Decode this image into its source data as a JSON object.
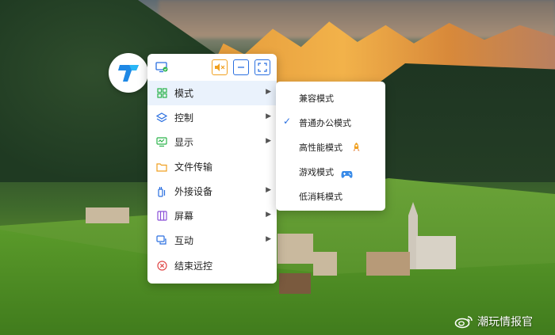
{
  "toolbar": {
    "screen_icon": "monitor-check-icon",
    "mute_icon": "speaker-mute-icon",
    "minimize_icon": "minimize-icon",
    "fullscreen_icon": "fullscreen-icon",
    "accent_color": "#f0a020"
  },
  "menu": {
    "items": [
      {
        "label": "模式",
        "icon": "grid-icon",
        "has_submenu": true,
        "active": true
      },
      {
        "label": "控制",
        "icon": "layers-icon",
        "has_submenu": true
      },
      {
        "label": "显示",
        "icon": "display-icon",
        "has_submenu": true
      },
      {
        "label": "文件传输",
        "icon": "folder-icon",
        "has_submenu": false
      },
      {
        "label": "外接设备",
        "icon": "plug-icon",
        "has_submenu": true
      },
      {
        "label": "屏幕",
        "icon": "screen-icon",
        "has_submenu": true
      },
      {
        "label": "互动",
        "icon": "chat-icon",
        "has_submenu": true
      },
      {
        "label": "结束远控",
        "icon": "close-circle-icon",
        "has_submenu": false
      }
    ]
  },
  "submenu": {
    "items": [
      {
        "label": "兼容模式",
        "checked": false,
        "badge": ""
      },
      {
        "label": "普通办公模式",
        "checked": true,
        "badge": ""
      },
      {
        "label": "高性能模式",
        "checked": false,
        "badge": "rocket-icon"
      },
      {
        "label": "游戏模式",
        "checked": false,
        "badge": "gamepad-icon"
      },
      {
        "label": "低消耗模式",
        "checked": false,
        "badge": ""
      }
    ]
  },
  "watermark": {
    "text": "潮玩情报官",
    "icon": "weibo-icon"
  }
}
